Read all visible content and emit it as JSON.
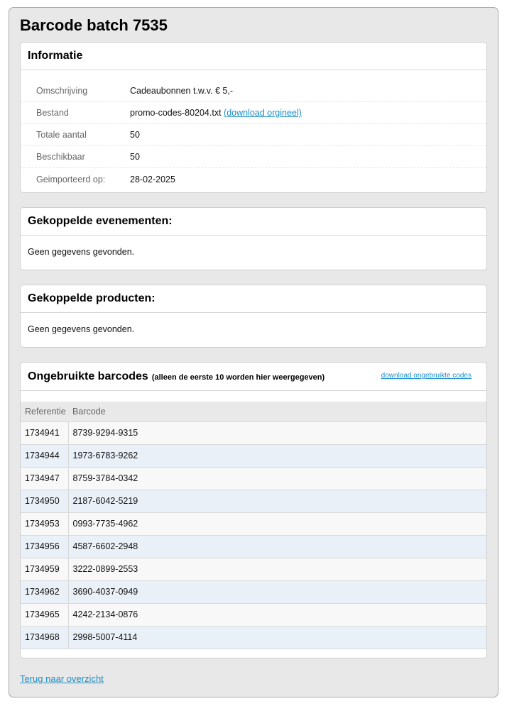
{
  "page": {
    "title": "Barcode batch 7535"
  },
  "info": {
    "heading": "Informatie",
    "rows": [
      {
        "label": "Omschrijving",
        "value": "Cadeaubonnen t.w.v. € 5,-"
      },
      {
        "label": "Bestand",
        "value": "promo-codes-80204.txt",
        "link": "(download orgineel)"
      },
      {
        "label": "Totale aantal",
        "value": "50"
      },
      {
        "label": "Beschikbaar",
        "value": "50"
      },
      {
        "label": "Geimporteerd op:",
        "value": "28-02-2025"
      }
    ]
  },
  "events": {
    "heading": "Gekoppelde evenementen:",
    "empty": "Geen gegevens gevonden."
  },
  "products": {
    "heading": "Gekoppelde producten:",
    "empty": "Geen gegevens gevonden."
  },
  "barcodes": {
    "heading": "Ongebruikte barcodes",
    "subheading": "(alleen de eerste 10 worden hier weergegeven)",
    "download_link": "download ongebruikte codes",
    "columns": [
      "Referentie",
      "Barcode"
    ],
    "rows": [
      {
        "ref": "1734941",
        "code": "8739-9294-9315"
      },
      {
        "ref": "1734944",
        "code": "1973-6783-9262"
      },
      {
        "ref": "1734947",
        "code": "8759-3784-0342"
      },
      {
        "ref": "1734950",
        "code": "2187-6042-5219"
      },
      {
        "ref": "1734953",
        "code": "0993-7735-4962"
      },
      {
        "ref": "1734956",
        "code": "4587-6602-2948"
      },
      {
        "ref": "1734959",
        "code": "3222-0899-2553"
      },
      {
        "ref": "1734962",
        "code": "3690-4037-0949"
      },
      {
        "ref": "1734965",
        "code": "4242-2134-0876"
      },
      {
        "ref": "1734968",
        "code": "2998-5007-4114"
      }
    ]
  },
  "footer": {
    "back_link": "Terug naar overzicht"
  },
  "colors": {
    "link": "#1a8ec9",
    "row_alt": "#eaf0f8",
    "panel_bg": "#e8e8e8"
  }
}
